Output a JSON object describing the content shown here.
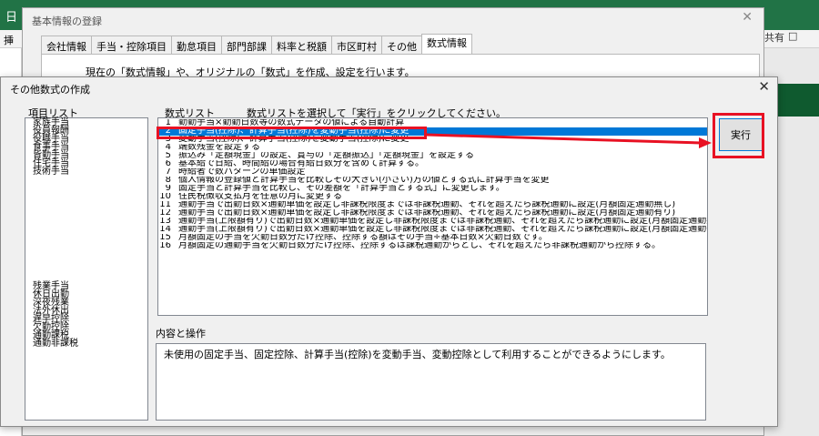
{
  "excel": {
    "share_label": "共有",
    "left_glyphs": [
      "日",
      "■",
      "挿"
    ],
    "comment_glyph": "□"
  },
  "bg_dialog": {
    "title": "基本情報の登録",
    "close": "✕",
    "tabs": [
      "会社情報",
      "手当・控除項目",
      "勤怠項目",
      "部門部課",
      "料率と税額",
      "市区町村",
      "その他",
      "数式情報"
    ],
    "active_tab_index": 7,
    "description": "現在の「数式情報」や、オリジナルの「数式」を作成、設定を行います。"
  },
  "dialog": {
    "title": "その他数式の作成",
    "close": "✕",
    "item_list_label": "項目リスト",
    "formula_list_label": "数式リスト",
    "formula_hint": "数式リストを選択して「実行」をクリックしてください。",
    "run_button": "実行",
    "content_label": "内容と操作",
    "content_text": "未使用の固定手当、固定控除、計算手当(控除)を変動手当、変動控除として利用することができるようにします。",
    "items_group1": [
      "家族手当",
      "役員報酬",
      "役職手当",
      "食事手当",
      "皆勤手当",
      "住宅手当",
      "技術手当"
    ],
    "items_group2": [
      "残業手当",
      "休日出勤",
      "深夜残業",
      "法外休出",
      "遅早控除",
      "欠勤控除",
      "通勤課税",
      "通勤非課税"
    ],
    "formulas": [
      {
        "no": "1",
        "text": "勤勤手当×勤勤日数等の数式データの値による自動計算"
      },
      {
        "no": "2",
        "text": "固定手当(控除)、計算手当(控除)を変動手当(控除)に変更"
      },
      {
        "no": "3",
        "text": "変動手当(控除)、計算手当(控除)を変動手当(控除)に変更"
      },
      {
        "no": "4",
        "text": "端数残金を設定する"
      },
      {
        "no": "5",
        "text": "振込み「定額現金」の設定、賞与の「定額振込」「定額現金」を設定する"
      },
      {
        "no": "6",
        "text": "基本給で日給、時間給の場合有給日数分を含めて計算する。"
      },
      {
        "no": "7",
        "text": "時給者で数パターンの単価設定"
      },
      {
        "no": "8",
        "text": "個人情報の登録値と計算手当を比較しその大きい(小さい)方の値とする式に計算手当を変更"
      },
      {
        "no": "9",
        "text": "固定手当と計算手当を比較し、その差額を「計算手当とする式」に変更します。"
      },
      {
        "no": "10",
        "text": "住民税徴収支払月を任意の月に変更する"
      },
      {
        "no": "11",
        "text": "通勤手当で出勤日数×通勤単価を設定し非課税限度までは非課税通勤、それを超えたら課税通勤に設定(月額固定通勤無し)"
      },
      {
        "no": "12",
        "text": "通勤手当で出勤日数×通勤単価を設定し非課税限度までは非課税通勤、それを超えたら課税通勤に設定(月額固定通勤有り)"
      },
      {
        "no": "13",
        "text": "通勤手当(上限額有り)で出勤日数×通勤単価を設定し非課税限度までは非課税通勤、それを超えたら課税通勤に設定(月額固定通勤無し)"
      },
      {
        "no": "14",
        "text": "通勤手当(上限額有り)で出勤日数×通勤単価を設定し非課税限度までは非課税通勤、それを超えたら課税通勤に設定(月額固定通勤有り)"
      },
      {
        "no": "15",
        "text": "月額固定の手当を欠勤日数分だけ控除、控除する額はその手当÷基本日数×欠勤日数です。"
      },
      {
        "no": "16",
        "text": "月額固定の通勤手当を欠勤日数分だけ控除、控除するは課税通勤からとし、それを超えたら非課税通勤から控除する。"
      }
    ],
    "selected_index": 1
  },
  "colors": {
    "excel_green": "#217346",
    "selection_blue": "#0078d7",
    "highlight_red": "#e81123"
  }
}
